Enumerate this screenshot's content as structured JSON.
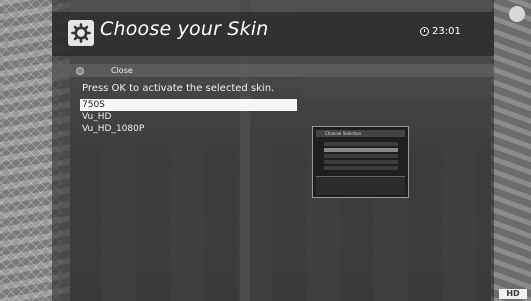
{
  "header": {
    "title": "Choose your Skin",
    "time": "23:01",
    "icon": "gear-icon"
  },
  "close_bar": {
    "label": "Close",
    "key_icon": "red-key-icon"
  },
  "hint": "Press OK to activate the selected skin.",
  "skins": [
    {
      "label": "750S",
      "selected": true
    },
    {
      "label": "Vu_HD",
      "selected": false
    },
    {
      "label": "Vu_HD_1080P",
      "selected": false
    }
  ],
  "preview": {
    "title": "Channel Selection"
  },
  "colors": {
    "selection": "#f6f6f6",
    "title": "#ffffff"
  }
}
